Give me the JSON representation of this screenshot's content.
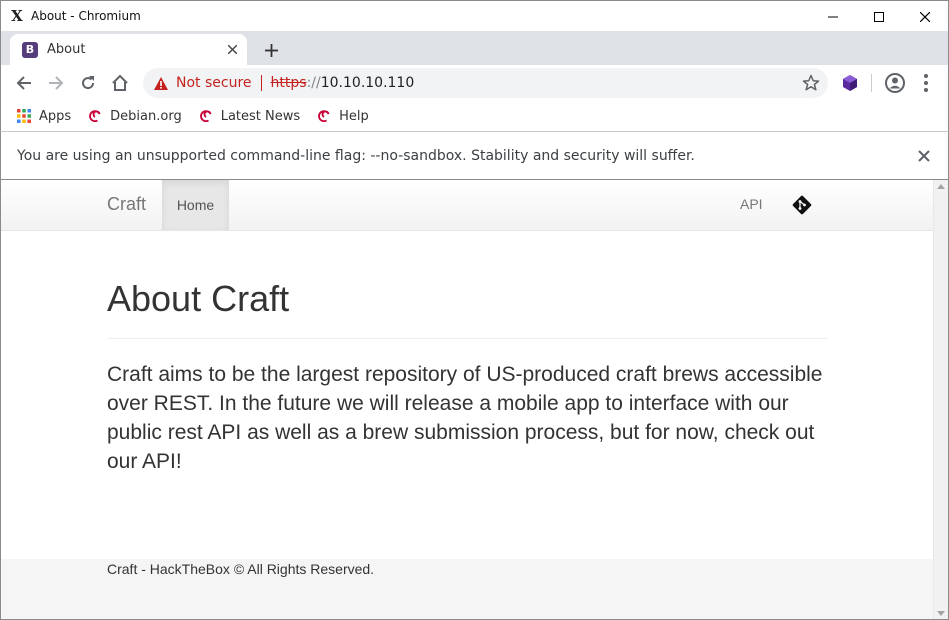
{
  "window": {
    "title": "About - Chromium",
    "app_icon": "x-logo-icon",
    "controls": [
      "minimize-icon",
      "maximize-icon",
      "close-icon"
    ]
  },
  "tabs": [
    {
      "label": "About",
      "favicon": "bootstrap-icon",
      "active": true
    }
  ],
  "toolbar": {
    "security_label": "Not secure",
    "url_scheme": "https",
    "url_separator": "://",
    "url_host": "10.10.10.110"
  },
  "bookmarks": [
    {
      "label": "Apps",
      "icon": "apps-grid-icon"
    },
    {
      "label": "Debian.org",
      "icon": "debian-icon"
    },
    {
      "label": "Latest News",
      "icon": "debian-icon"
    },
    {
      "label": "Help",
      "icon": "debian-icon"
    }
  ],
  "infobar": {
    "message": "You are using an unsupported command-line flag: --no-sandbox. Stability and security will suffer."
  },
  "site": {
    "brand": "Craft",
    "nav_home": "Home",
    "nav_api": "API",
    "heading": "About Craft",
    "body": "Craft aims to be the largest repository of US-produced craft brews accessible over REST. In the future we will release a mobile app to interface with our public rest API as well as a brew submission process, but for now, check out our API!",
    "footer": "Craft - HackTheBox © All Rights Reserved."
  },
  "colors": {
    "not_secure": "#c5221f",
    "tab_strip": "#dee1e6",
    "omnibox": "#f1f3f4",
    "bootstrap_purple": "#563d7c"
  }
}
